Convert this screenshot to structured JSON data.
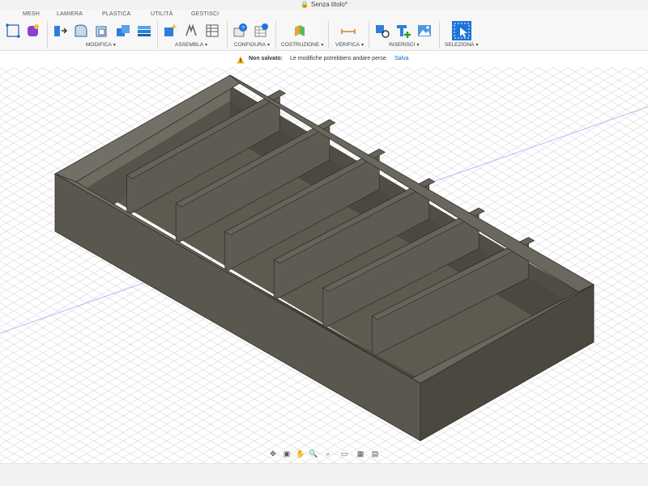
{
  "window": {
    "title": "Senza titolo*"
  },
  "tabs": [
    "MESH",
    "LAMIERA",
    "PLASTICA",
    "UTILITÀ",
    "GESTISCI"
  ],
  "groups": {
    "modifica": "MODIFICA",
    "assembla": "ASSEMBLA",
    "configura": "CONFIGURA",
    "costruzione": "COSTRUZIONE",
    "verifica": "VERIFICA",
    "inserisci": "INSERISCI",
    "seleziona": "SELEZIONA"
  },
  "notification": {
    "status": "Non salvato:",
    "message": "Le modifiche potrebbero andare perse",
    "action": "Salva"
  },
  "colors": {
    "accent": "#0a69c9",
    "model_top": "#66635a",
    "model_front": "#575549",
    "model_side": "#4a483e",
    "model_inner": "#5e5c52",
    "grid": "#d8d8d8"
  },
  "icons": {
    "ribbon": [
      "sketch-icon",
      "form-icon",
      "extrude-icon",
      "fillet-icon",
      "shell-icon",
      "combine-icon",
      "stack-icon",
      "new-component-icon",
      "joint-icon",
      "bom-icon",
      "parameters-icon",
      "configure-table-icon",
      "construct-plane-icon",
      "measure-icon",
      "insert-derive-icon",
      "insert-mesh-icon",
      "insert-canvas-icon",
      "select-icon"
    ],
    "navbar": [
      "orbit-icon",
      "look-at-icon",
      "pan-icon",
      "zoom-icon",
      "fit-icon",
      "display-settings-icon",
      "grid-settings-icon",
      "viewports-icon"
    ]
  }
}
